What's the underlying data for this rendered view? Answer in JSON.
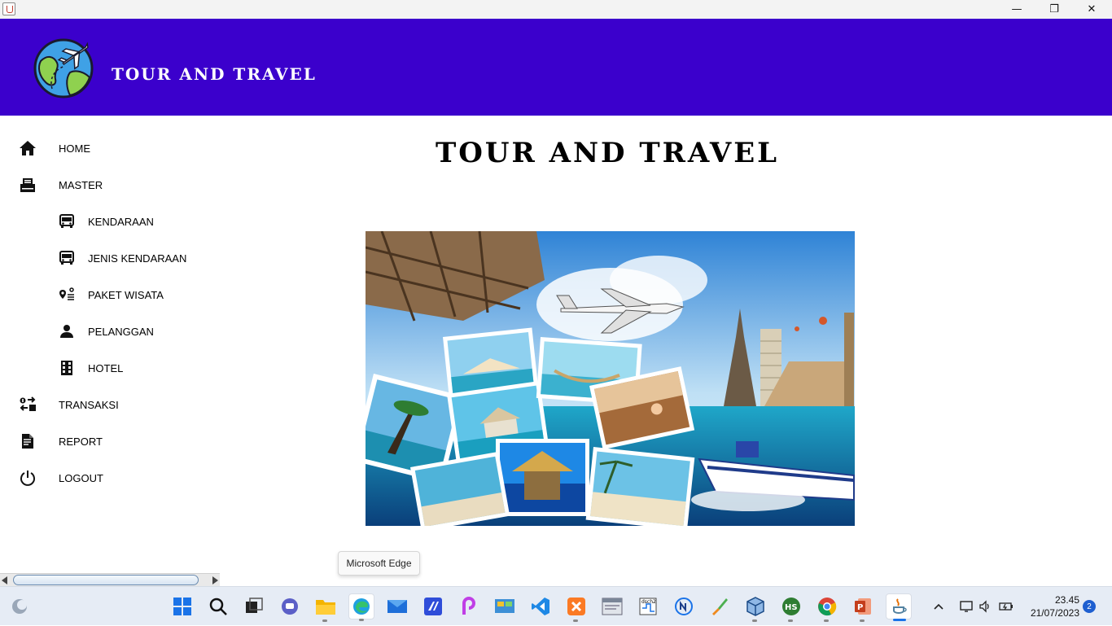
{
  "window": {
    "minimize_glyph": "—",
    "maximize_glyph": "❐",
    "close_glyph": "✕"
  },
  "header": {
    "title": "TOUR AND TRAVEL",
    "colors": {
      "background": "#3b00cc",
      "text": "#ffffff"
    }
  },
  "sidebar": {
    "items": [
      {
        "label": "HOME",
        "icon": "home-icon"
      },
      {
        "label": "MASTER",
        "icon": "inbox-tray-icon"
      },
      {
        "label": "KENDARAAN",
        "icon": "bus-icon"
      },
      {
        "label": "JENIS KENDARAAN",
        "icon": "bus-icon"
      },
      {
        "label": "PAKET WISATA",
        "icon": "location-route-icon"
      },
      {
        "label": "PELANGGAN",
        "icon": "person-icon"
      },
      {
        "label": "HOTEL",
        "icon": "building-icon"
      },
      {
        "label": "TRANSAKSI",
        "icon": "exchange-icon"
      },
      {
        "label": "REPORT",
        "icon": "report-document-icon"
      },
      {
        "label": "LOGOUT",
        "icon": "power-icon"
      }
    ]
  },
  "main": {
    "title": "TOUR AND TRAVEL"
  },
  "tooltip": {
    "text": "Microsoft Edge"
  },
  "taskbar": {
    "clock_time": "23.45",
    "clock_date": "21/07/2023",
    "notification_count": "2",
    "pinned": [
      "start",
      "search",
      "task-view",
      "chat",
      "file-explorer",
      "edge",
      "mail",
      "visual-studio",
      "picsart",
      "control-panel",
      "vscode",
      "xampp",
      "window-app",
      "dsch2",
      "network-app",
      "paint-app",
      "virtualbox",
      "hs-app",
      "chrome",
      "powerpoint",
      "java"
    ]
  }
}
